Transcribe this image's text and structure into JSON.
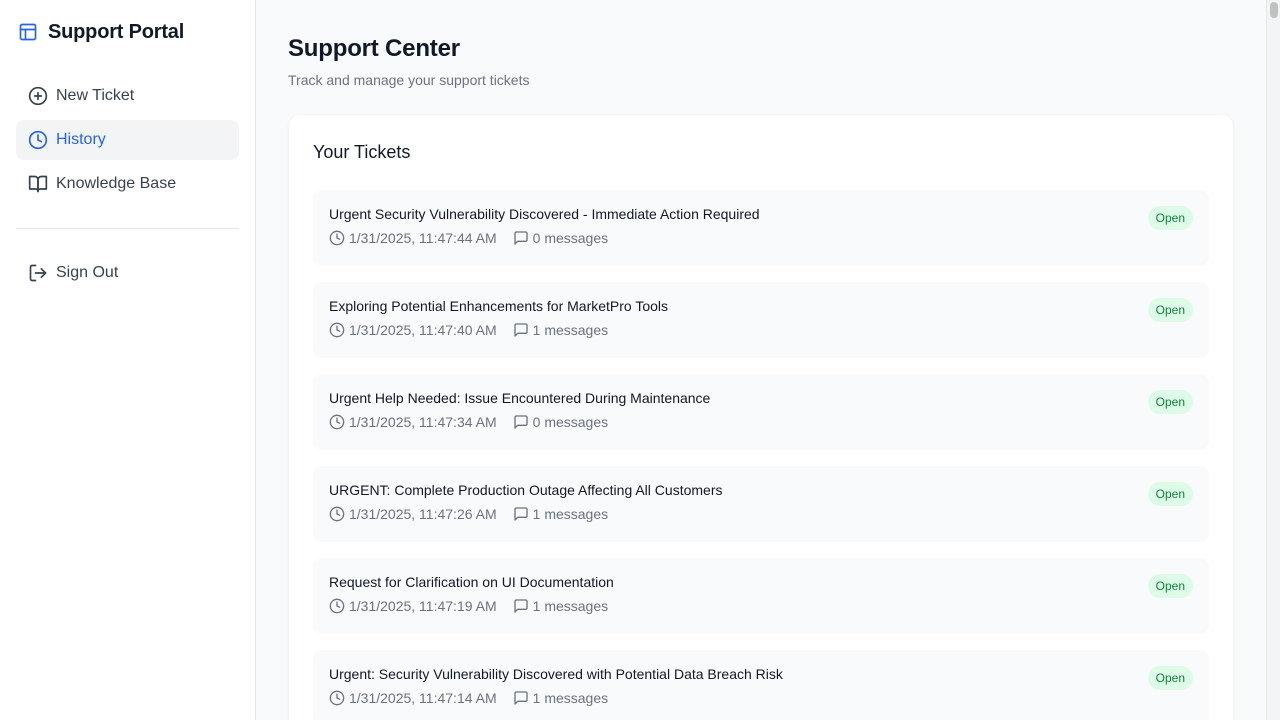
{
  "app": {
    "title": "Support Portal"
  },
  "sidebar": {
    "items": [
      {
        "label": "New Ticket",
        "icon": "plus-circle-icon",
        "active": false
      },
      {
        "label": "History",
        "icon": "clock-icon",
        "active": true
      },
      {
        "label": "Knowledge Base",
        "icon": "book-open-icon",
        "active": false
      }
    ],
    "sign_out": {
      "label": "Sign Out",
      "icon": "log-out-icon"
    }
  },
  "main": {
    "title": "Support Center",
    "subtitle": "Track and manage your support tickets",
    "card_title": "Your Tickets",
    "tickets": [
      {
        "title": "Urgent Security Vulnerability Discovered - Immediate Action Required",
        "timestamp": "1/31/2025, 11:47:44 AM",
        "messages": "0 messages",
        "status": "Open"
      },
      {
        "title": "Exploring Potential Enhancements for MarketPro Tools",
        "timestamp": "1/31/2025, 11:47:40 AM",
        "messages": "1 messages",
        "status": "Open"
      },
      {
        "title": "Urgent Help Needed: Issue Encountered During Maintenance",
        "timestamp": "1/31/2025, 11:47:34 AM",
        "messages": "0 messages",
        "status": "Open"
      },
      {
        "title": "URGENT: Complete Production Outage Affecting All Customers",
        "timestamp": "1/31/2025, 11:47:26 AM",
        "messages": "1 messages",
        "status": "Open"
      },
      {
        "title": "Request for Clarification on UI Documentation",
        "timestamp": "1/31/2025, 11:47:19 AM",
        "messages": "1 messages",
        "status": "Open"
      },
      {
        "title": "Urgent: Security Vulnerability Discovered with Potential Data Breach Risk",
        "timestamp": "1/31/2025, 11:47:14 AM",
        "messages": "1 messages",
        "status": "Open"
      }
    ]
  },
  "colors": {
    "accent": "#2563eb",
    "status_open_bg": "#dcfce7",
    "status_open_text": "#15803d"
  }
}
